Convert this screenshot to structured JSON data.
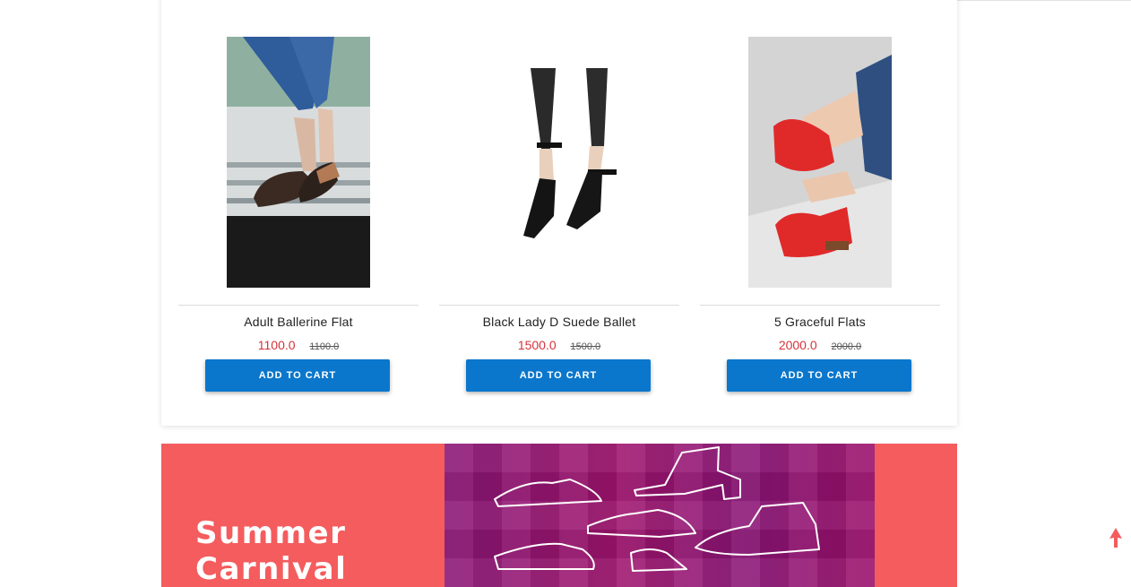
{
  "products": [
    {
      "name": "Adult Ballerine Flat",
      "price": "1100.0",
      "old_price": "1100.0",
      "button": "ADD TO CART",
      "image": "ballerina-flat-photo"
    },
    {
      "name": "Black Lady D Suede Ballet",
      "price": "1500.0",
      "old_price": "1500.0",
      "button": "ADD TO CART",
      "image": "black-suede-ballet-photo"
    },
    {
      "name": "5 Graceful Flats",
      "price": "2000.0",
      "old_price": "2000.0",
      "button": "ADD TO CART",
      "image": "red-flats-photo"
    }
  ],
  "banner": {
    "title_line1": "Summer",
    "title_line2": "Carnival",
    "background": "#f45c5e"
  },
  "colors": {
    "button": "#0a77cc",
    "price": "#d6323a",
    "scroll_top": "#f45c5e"
  },
  "icons": {
    "scroll_top": "arrow-up-icon"
  }
}
